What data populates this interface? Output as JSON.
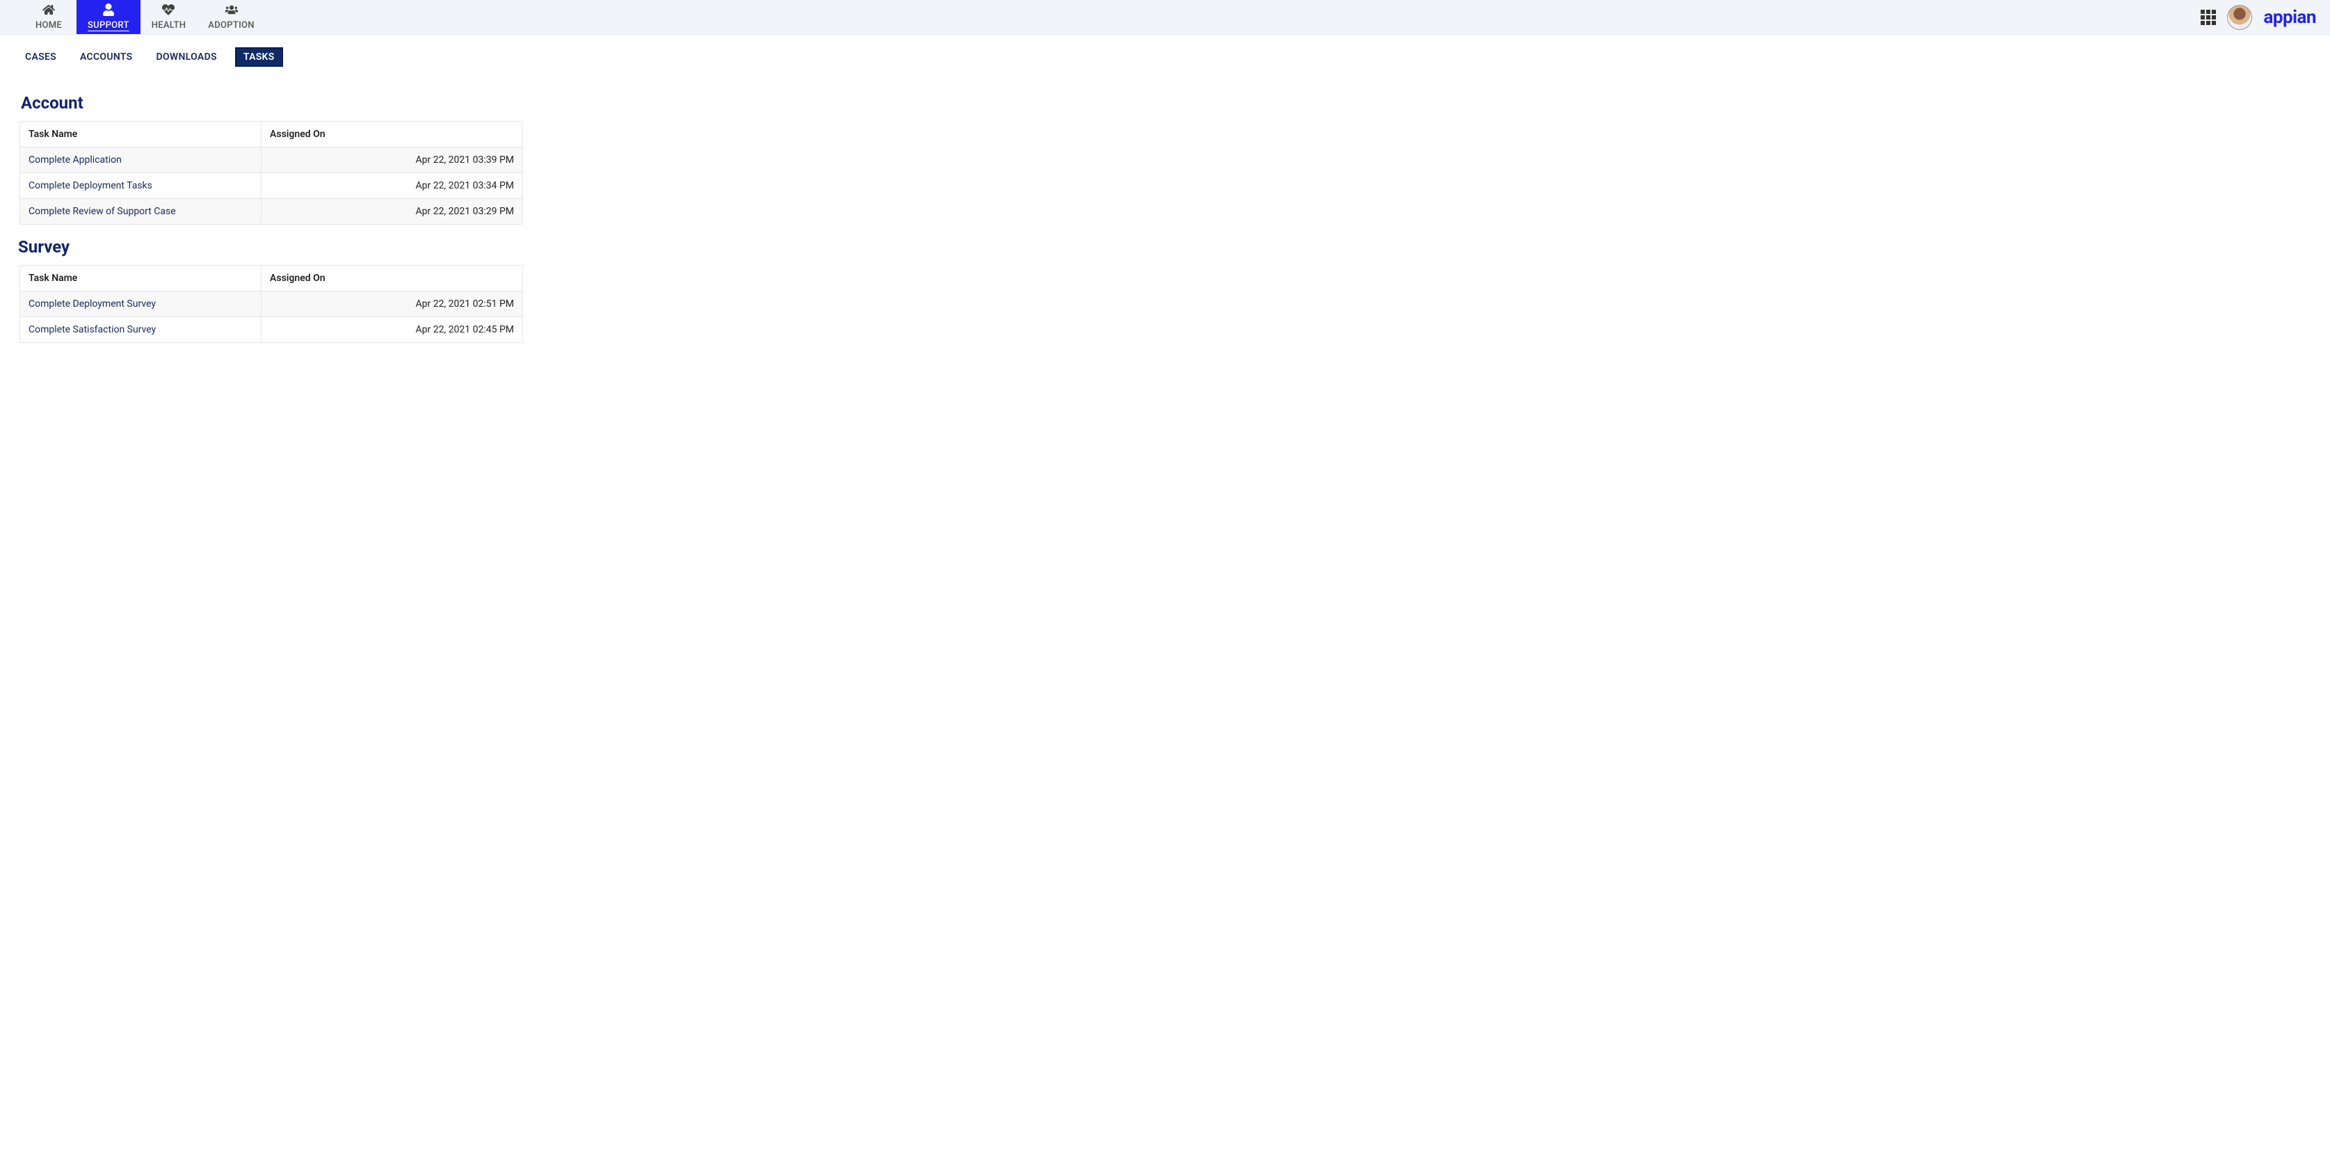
{
  "topnav": {
    "items": [
      {
        "label": "HOME",
        "icon": "home-icon"
      },
      {
        "label": "SUPPORT",
        "icon": "user-icon",
        "active": true
      },
      {
        "label": "HEALTH",
        "icon": "heartbeat-icon"
      },
      {
        "label": "ADOPTION",
        "icon": "users-icon"
      }
    ],
    "logo_text": "appian"
  },
  "subtabs": {
    "items": [
      {
        "label": "CASES"
      },
      {
        "label": "ACCOUNTS"
      },
      {
        "label": "DOWNLOADS"
      },
      {
        "label": "TASKS",
        "active": true
      }
    ]
  },
  "sections": [
    {
      "title": "Account",
      "columns": [
        "Task Name",
        "Assigned On"
      ],
      "rows": [
        {
          "name": "Complete Application",
          "date": "Apr 22, 2021 03:39 PM"
        },
        {
          "name": "Complete Deployment Tasks",
          "date": "Apr 22, 2021 03:34 PM"
        },
        {
          "name": "Complete Review of Support Case",
          "date": "Apr 22, 2021 03:29 PM"
        }
      ]
    },
    {
      "title": "Survey",
      "columns": [
        "Task Name",
        "Assigned On"
      ],
      "rows": [
        {
          "name": "Complete Deployment Survey",
          "date": "Apr 22, 2021 02:51 PM"
        },
        {
          "name": "Complete Satisfaction Survey",
          "date": "Apr 22, 2021 02:45 PM"
        }
      ]
    }
  ]
}
